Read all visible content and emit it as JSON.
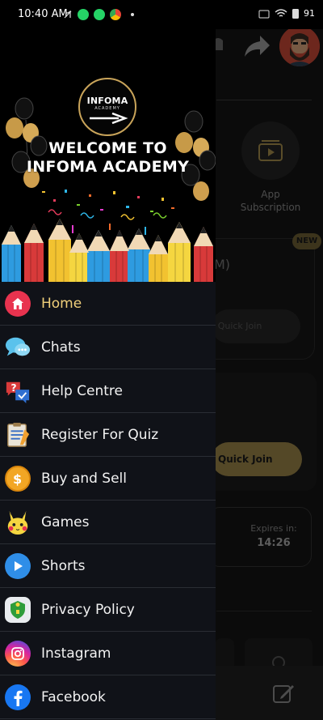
{
  "status_bar": {
    "time": "10:40 AM",
    "battery": "91"
  },
  "drawer": {
    "banner": {
      "logo_text": "INFOMA",
      "logo_subtext": "ACADEMY",
      "welcome_line1": "WELCOME TO",
      "welcome_line2": "INFOMA ACADEMY"
    },
    "menu": [
      {
        "label": "Home",
        "icon": "home-icon",
        "active": true
      },
      {
        "label": "Chats",
        "icon": "chat-bubbles-icon"
      },
      {
        "label": "Help Centre",
        "icon": "help-icon"
      },
      {
        "label": "Register For Quiz",
        "icon": "clipboard-icon"
      },
      {
        "label": "Buy and Sell",
        "icon": "coin-icon"
      },
      {
        "label": "Games",
        "icon": "pikachu-icon"
      },
      {
        "label": "Shorts",
        "icon": "play-icon"
      },
      {
        "label": "Privacy Policy",
        "icon": "shield-icon"
      },
      {
        "label": "Instagram",
        "icon": "instagram-icon"
      },
      {
        "label": "Facebook",
        "icon": "facebook-icon"
      }
    ]
  },
  "background": {
    "app_subscription_label": "App Subscription",
    "badge_new": "NEW",
    "card1_partial": "M)",
    "quick_join": "Quick Join",
    "expires_label": "Expires in:",
    "expires_time": "14:26"
  },
  "colors": {
    "accent_gold": "#f0cf7a",
    "drawer_bg": "#101218",
    "home_icon_bg": "#e8334f"
  }
}
